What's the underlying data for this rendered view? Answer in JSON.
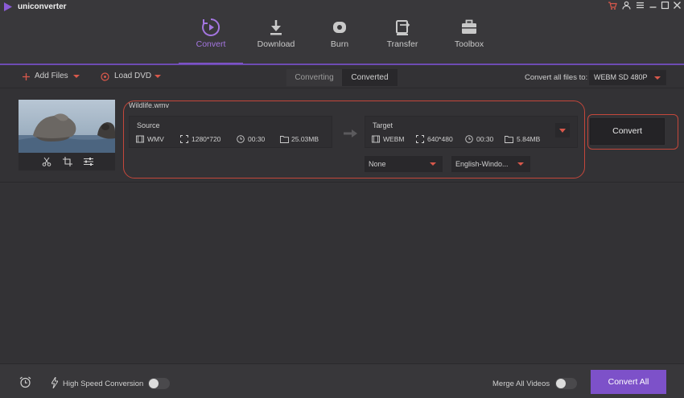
{
  "app": {
    "title": "uniconverter"
  },
  "window_controls": {
    "cart_icon": "cart-icon",
    "account_icon": "account-icon",
    "menu_icon": "menu-icon",
    "minimize_icon": "minimize-icon",
    "maximize_icon": "maximize-icon",
    "close_icon": "close-icon"
  },
  "nav": [
    {
      "label": "Convert",
      "icon": "convert-icon",
      "active": true
    },
    {
      "label": "Download",
      "icon": "download-icon",
      "active": false
    },
    {
      "label": "Burn",
      "icon": "disc-icon",
      "active": false
    },
    {
      "label": "Transfer",
      "icon": "transfer-icon",
      "active": false
    },
    {
      "label": "Toolbox",
      "icon": "toolbox-icon",
      "active": false
    }
  ],
  "toolbar": {
    "add_files": "Add Files",
    "load_dvd": "Load DVD",
    "tab_converting": "Converting",
    "tab_converted": "Converted",
    "convert_all_files_to": "Convert all files to:",
    "format": "WEBM SD 480P"
  },
  "file": {
    "name": "Wildlife.wmv",
    "source": {
      "title": "Source",
      "format": "WMV",
      "resolution": "1280*720",
      "duration": "00:30",
      "size": "25.03MB"
    },
    "target": {
      "title": "Target",
      "format": "WEBM",
      "resolution": "640*480",
      "duration": "00:30",
      "size": "5.84MB"
    },
    "subtitle": "None",
    "audio_track": "English-Windo...",
    "convert_button": "Convert"
  },
  "footer": {
    "high_speed": "High Speed Conversion",
    "high_speed_on": false,
    "merge_all": "Merge All Videos",
    "merge_on": false,
    "convert_all": "Convert All"
  },
  "colors": {
    "accent": "#7d51c9",
    "highlight": "#c4473b",
    "caret": "#d9584b"
  }
}
